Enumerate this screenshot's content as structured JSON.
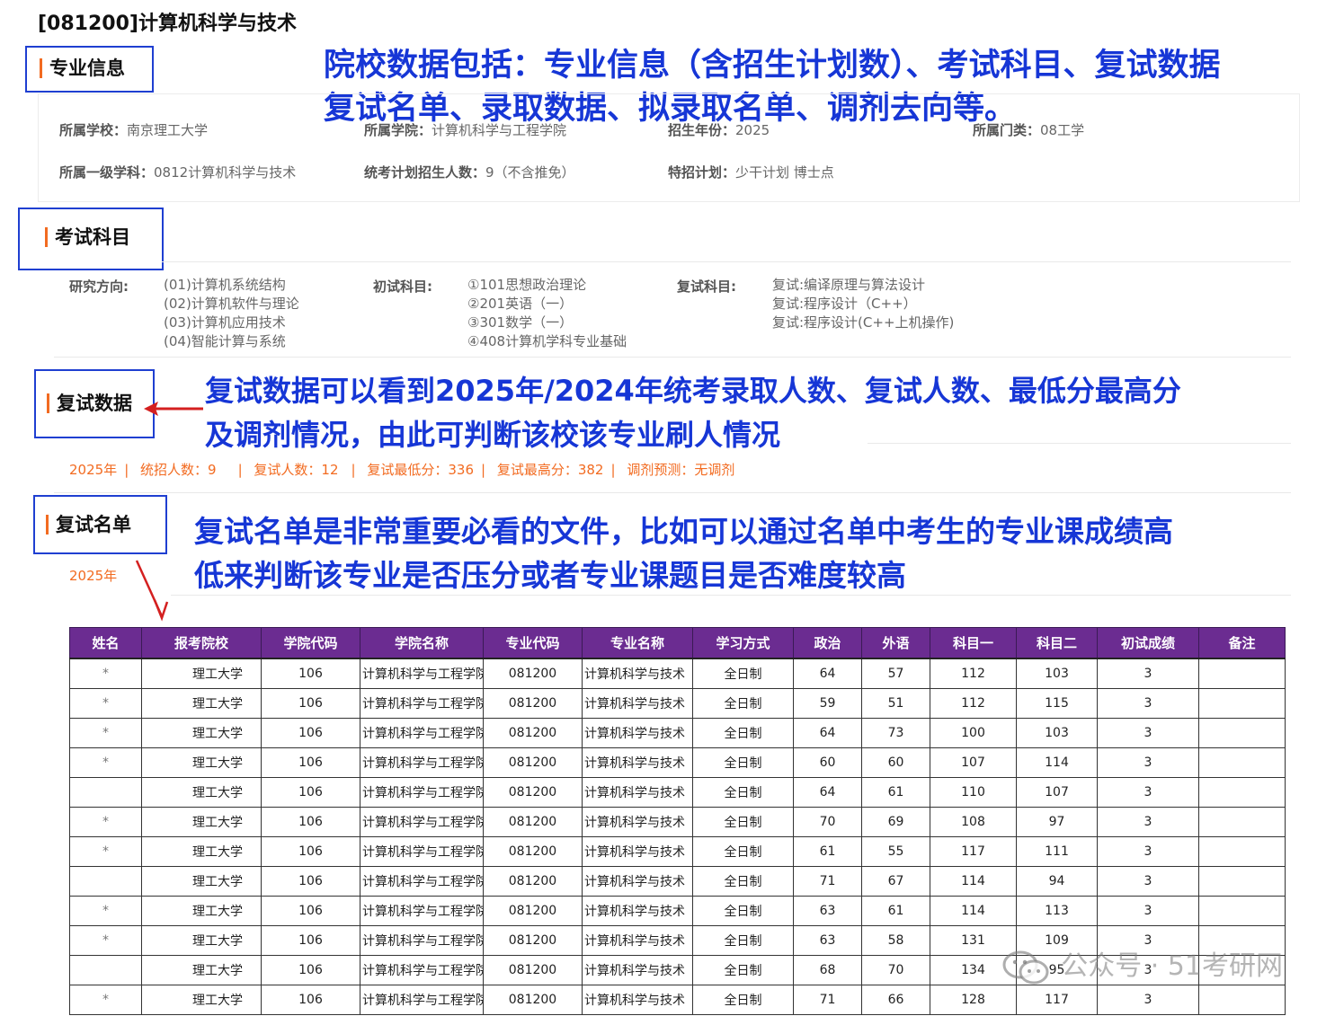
{
  "page_title": "[081200]计算机科学与技术",
  "sections": {
    "major_info": "专业信息",
    "exam_subjects": "考试科目",
    "retest_data": "复试数据",
    "retest_list": "复试名单"
  },
  "annotations": {
    "top_line1": "院校数据包括：专业信息（含招生计划数）、考试科目、复试数据",
    "top_line2": "复试名单、录取数据、拟录取名单、调剂去向等。",
    "mid_line1": "复试数据可以看到2025年/2024年统考录取人数、复试人数、最低分最高分",
    "mid_line2": "及调剂情况，由此可判断该校该专业刷人情况",
    "low_line1": "复试名单是非常重要必看的文件，比如可以通过名单中考生的专业课成绩高",
    "low_line2": "低来判断该专业是否压分或者专业课题目是否难度较高"
  },
  "major_info": {
    "school_label": "所属学校：",
    "school": "南京理工大学",
    "college_label": "所属学院：",
    "college": "计算机科学与工程学院",
    "year_label": "招生年份：",
    "year": "2025",
    "category_label": "所属门类：",
    "category": "08工学",
    "discipline_label": "所属一级学科：",
    "discipline": "0812计算机科学与技术",
    "plan_label": "统考计划招生人数：",
    "plan": "9（不含推免）",
    "special_label": "特招计划：",
    "special": "少干计划 博士点"
  },
  "exam": {
    "direction_label": "研究方向:",
    "directions": [
      "(01)计算机系统结构",
      "(02)计算机软件与理论",
      "(03)计算机应用技术",
      "(04)智能计算与系统"
    ],
    "initial_label": "初试科目:",
    "initial_subjects": [
      "①101思想政治理论",
      "②201英语（一）",
      "③301数学（一）",
      "④408计算机学科专业基础"
    ],
    "retest_label": "复试科目:",
    "retest_subjects": [
      "复试:编译原理与算法设计",
      "复试:程序设计（C++）",
      "复试:程序设计(C++上机操作)"
    ]
  },
  "retest_stats": {
    "year": "2025年",
    "enrolled": "统招人数：9",
    "retest_count": "复试人数：12",
    "min_score": "复试最低分：336",
    "max_score": "复试最高分：382",
    "adjust": "调剂预测：无调剂"
  },
  "retest_list_year": "2025年",
  "table": {
    "headers": [
      "姓名",
      "报考院校",
      "学院代码",
      "学院名称",
      "专业代码",
      "专业名称",
      "学习方式",
      "政治",
      "外语",
      "科目一",
      "科目二",
      "初试成绩",
      "备注"
    ],
    "rows": [
      [
        "*",
        "理工大学",
        "106",
        "计算机科学与工程学院",
        "081200",
        "计算机科学与技术",
        "全日制",
        "64",
        "57",
        "112",
        "103",
        "3",
        ""
      ],
      [
        "*",
        "理工大学",
        "106",
        "计算机科学与工程学院",
        "081200",
        "计算机科学与技术",
        "全日制",
        "59",
        "51",
        "112",
        "115",
        "3",
        ""
      ],
      [
        "*",
        "理工大学",
        "106",
        "计算机科学与工程学院",
        "081200",
        "计算机科学与技术",
        "全日制",
        "64",
        "73",
        "100",
        "103",
        "3",
        ""
      ],
      [
        "*",
        "理工大学",
        "106",
        "计算机科学与工程学院",
        "081200",
        "计算机科学与技术",
        "全日制",
        "60",
        "60",
        "107",
        "114",
        "3",
        ""
      ],
      [
        "",
        "理工大学",
        "106",
        "计算机科学与工程学院",
        "081200",
        "计算机科学与技术",
        "全日制",
        "64",
        "61",
        "110",
        "107",
        "3",
        ""
      ],
      [
        "*",
        "理工大学",
        "106",
        "计算机科学与工程学院",
        "081200",
        "计算机科学与技术",
        "全日制",
        "70",
        "69",
        "108",
        "97",
        "3",
        ""
      ],
      [
        "*",
        "理工大学",
        "106",
        "计算机科学与工程学院",
        "081200",
        "计算机科学与技术",
        "全日制",
        "61",
        "55",
        "117",
        "111",
        "3",
        ""
      ],
      [
        "",
        "理工大学",
        "106",
        "计算机科学与工程学院",
        "081200",
        "计算机科学与技术",
        "全日制",
        "71",
        "67",
        "114",
        "94",
        "3",
        ""
      ],
      [
        "*",
        "理工大学",
        "106",
        "计算机科学与工程学院",
        "081200",
        "计算机科学与技术",
        "全日制",
        "63",
        "61",
        "114",
        "113",
        "3",
        ""
      ],
      [
        "*",
        "理工大学",
        "106",
        "计算机科学与工程学院",
        "081200",
        "计算机科学与技术",
        "全日制",
        "63",
        "58",
        "131",
        "109",
        "3",
        ""
      ],
      [
        "",
        "理工大学",
        "106",
        "计算机科学与工程学院",
        "081200",
        "计算机科学与技术",
        "全日制",
        "68",
        "70",
        "134",
        "95",
        "3",
        ""
      ],
      [
        "*",
        "理工大学",
        "106",
        "计算机科学与工程学院",
        "081200",
        "计算机科学与技术",
        "全日制",
        "71",
        "66",
        "128",
        "117",
        "3",
        ""
      ]
    ]
  },
  "watermark": "公众号 · 51考研网",
  "colors": {
    "accent": "#f26b21",
    "annotation": "#1636d6",
    "header_bg": "#6b2c91",
    "arrow": "#d42020"
  },
  "icons": {
    "wechat": "wechat-icon"
  }
}
